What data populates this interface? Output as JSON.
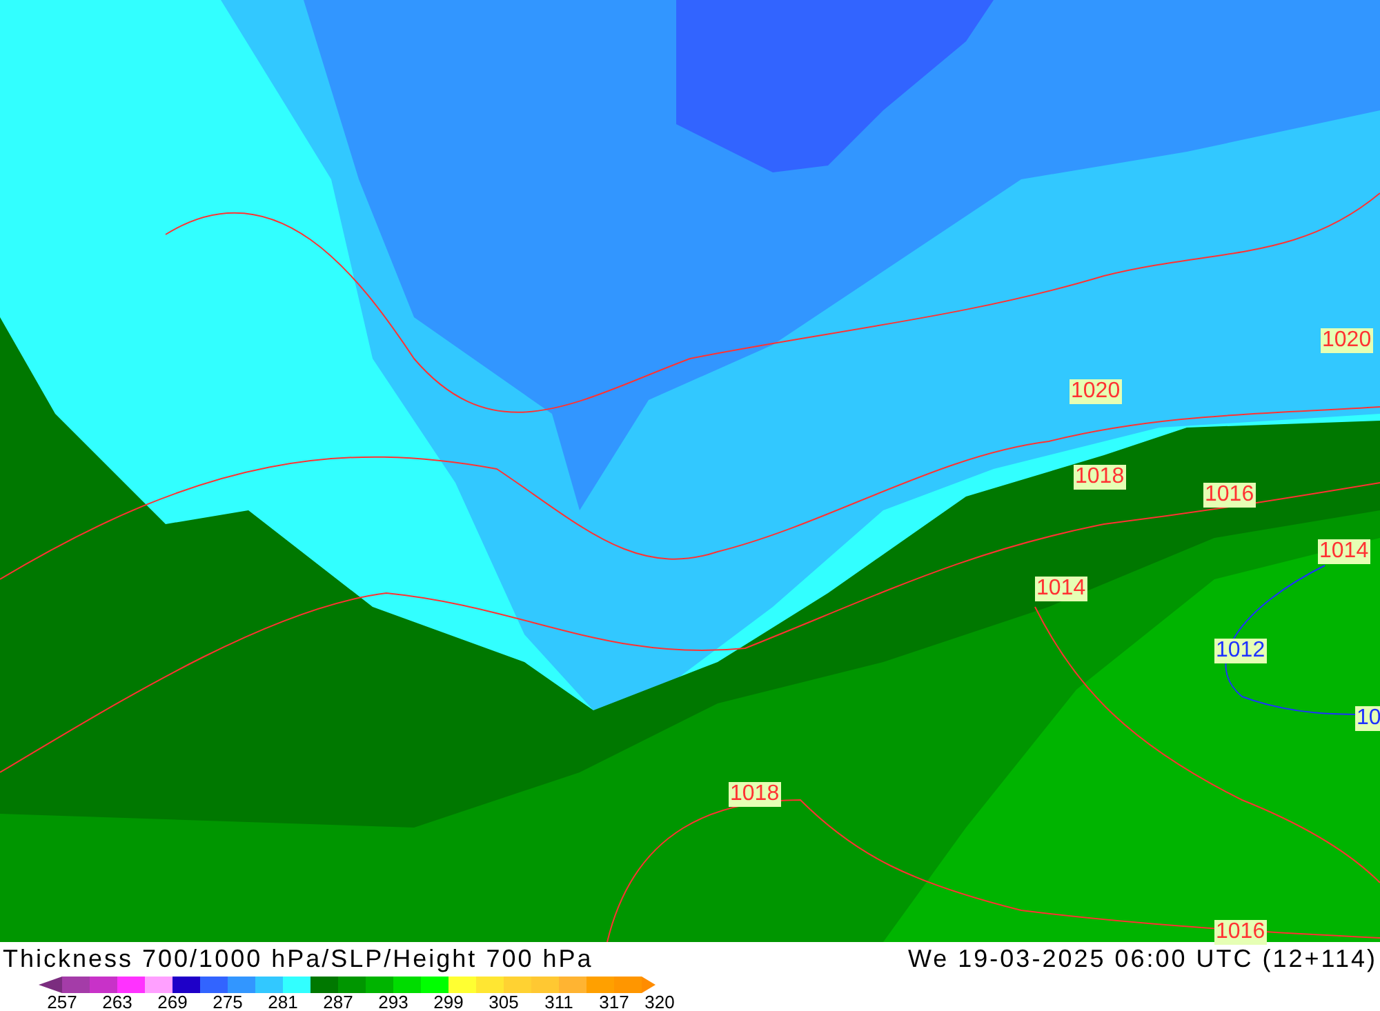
{
  "map": {
    "isobar_labels": [
      {
        "text": "1020",
        "color": "#ff3232"
      },
      {
        "text": "1020",
        "color": "#ff3232"
      },
      {
        "text": "1018",
        "color": "#ff3232"
      },
      {
        "text": "1016",
        "color": "#ff3232"
      },
      {
        "text": "1014",
        "color": "#ff3232"
      },
      {
        "text": "1014",
        "color": "#ff3232"
      },
      {
        "text": "1012",
        "color": "#1e32ff"
      },
      {
        "text": "10",
        "color": "#1e32ff"
      },
      {
        "text": "1018",
        "color": "#ff3232"
      },
      {
        "text": "1016",
        "color": "#ff3232"
      }
    ]
  },
  "title": "Thickness 700/1000 hPa/SLP/Height 700 hPa",
  "valid_time": "We 19-03-2025 06:00 UTC (12+114)",
  "legend": {
    "start_arrow": {
      "color": "#7b2d7f"
    },
    "end_arrow": {
      "color": "#ff8c00"
    },
    "swatches": [
      {
        "color": "#a43ca8"
      },
      {
        "color": "#c832c8"
      },
      {
        "color": "#ff32ff"
      },
      {
        "color": "#ffa0ff"
      },
      {
        "color": "#1e00c8"
      },
      {
        "color": "#3264ff"
      },
      {
        "color": "#3296ff"
      },
      {
        "color": "#32c8ff"
      },
      {
        "color": "#32ffff"
      },
      {
        "color": "#007800"
      },
      {
        "color": "#009600"
      },
      {
        "color": "#00b400"
      },
      {
        "color": "#00dc00"
      },
      {
        "color": "#00ff00"
      },
      {
        "color": "#ffff32"
      },
      {
        "color": "#ffe632"
      },
      {
        "color": "#ffd232"
      },
      {
        "color": "#ffc832"
      },
      {
        "color": "#ffb432"
      },
      {
        "color": "#ffa000"
      },
      {
        "color": "#ff9600"
      }
    ],
    "ticks": [
      "257",
      "263",
      "269",
      "275",
      "281",
      "287",
      "293",
      "299",
      "305",
      "311",
      "317",
      "320"
    ]
  }
}
